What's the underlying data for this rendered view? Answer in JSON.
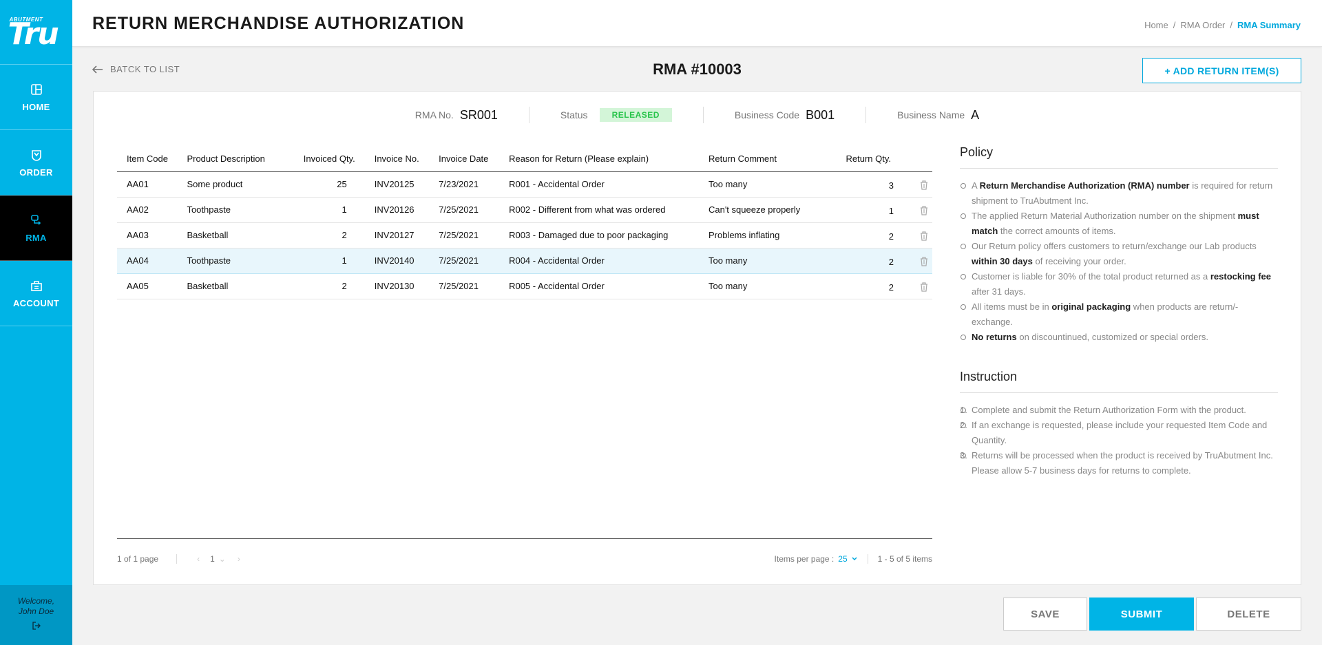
{
  "logo": {
    "top_text": "ABUTMENT",
    "main_text": "Tru"
  },
  "sidebar": {
    "items": [
      {
        "label": "HOME",
        "icon": "home-icon"
      },
      {
        "label": "ORDER",
        "icon": "order-icon"
      },
      {
        "label": "RMA",
        "icon": "rma-icon"
      },
      {
        "label": "ACCOUNT",
        "icon": "account-icon"
      }
    ],
    "welcome_line1": "Welcome,",
    "welcome_line2": "John Doe"
  },
  "header": {
    "title": "RETURN MERCHANDISE AUTHORIZATION",
    "breadcrumb": [
      "Home",
      "RMA Order",
      "RMA Summary"
    ],
    "breadcrumb_sep": "/"
  },
  "toolbar": {
    "back_label": "BATCK TO LIST",
    "rma_title": "RMA #10003",
    "add_label": "+ ADD RETURN ITEM(S)"
  },
  "info": {
    "rma_no_label": "RMA No.",
    "rma_no": "SR001",
    "status_label": "Status",
    "status": "RELEASED",
    "business_code_label": "Business Code",
    "business_code": "B001",
    "business_name_label": "Business Name",
    "business_name": "A"
  },
  "table": {
    "columns": [
      "Item Code",
      "Product Description",
      "Invoiced Qty.",
      "Invoice No.",
      "Invoice Date",
      "Reason for Return (Please explain)",
      "Return Comment",
      "Return Qty."
    ],
    "rows": [
      [
        "AA01",
        "Some product",
        "25",
        "INV20125",
        "7/23/2021",
        "R001 - Accidental Order",
        "Too many",
        "3"
      ],
      [
        "AA02",
        "Toothpaste",
        "1",
        "INV20126",
        "7/25/2021",
        "R002 - Different from what was ordered",
        "Can't squeeze properly",
        "1"
      ],
      [
        "AA03",
        "Basketball",
        "2",
        "INV20127",
        "7/25/2021",
        "R003 - Damaged due to poor packaging",
        "Problems inflating",
        "2"
      ],
      [
        "AA04",
        "Toothpaste",
        "1",
        "INV20140",
        "7/25/2021",
        "R004 - Accidental Order",
        "Too many",
        "2"
      ],
      [
        "AA05",
        "Basketball",
        "2",
        "INV20130",
        "7/25/2021",
        "R005 - Accidental Order",
        "Too many",
        "2"
      ]
    ]
  },
  "pager": {
    "page_info": "1 of 1 page",
    "current_page": "1",
    "per_page_label": "Items per page :",
    "per_page": "25",
    "range": "1 - 5 of 5 items"
  },
  "policy": {
    "title": "Policy",
    "items": [
      [
        "A ",
        "Return Merchandise Authorization (RMA) number",
        " is required for return shipment to TruAbutment Inc."
      ],
      [
        "The applied Return Material Authorization number on the shipment ",
        "must match",
        " the correct amounts of items."
      ],
      [
        "Our Return policy offers customers to return/exchange our Lab products ",
        "within 30 days",
        " of receiving your order."
      ],
      [
        "Customer is liable for 30% of the total product returned as a ",
        "restocking fee",
        " after 31 days."
      ],
      [
        "All items must be in ",
        "original packaging",
        " when products are return/-exchange."
      ],
      [
        "",
        "No returns",
        " on discountinued, customized or special orders."
      ]
    ]
  },
  "instruction": {
    "title": "Instruction",
    "items": [
      "Complete and submit the Return Authorization Form with the product.",
      "If an exchange is requested, please include your requested Item Code and Quantity.",
      "Returns will be processed when the product is received by TruAbutment Inc."
    ],
    "extra": "Please allow 5-7 business days for returns to complete."
  },
  "actions": {
    "save": "SAVE",
    "submit": "SUBMIT",
    "delete": "DELETE"
  },
  "colors": {
    "brand": "#00b4e6",
    "active_nav": "#000000",
    "status_bg": "#d3f5d8",
    "status_text": "#27c44a"
  }
}
